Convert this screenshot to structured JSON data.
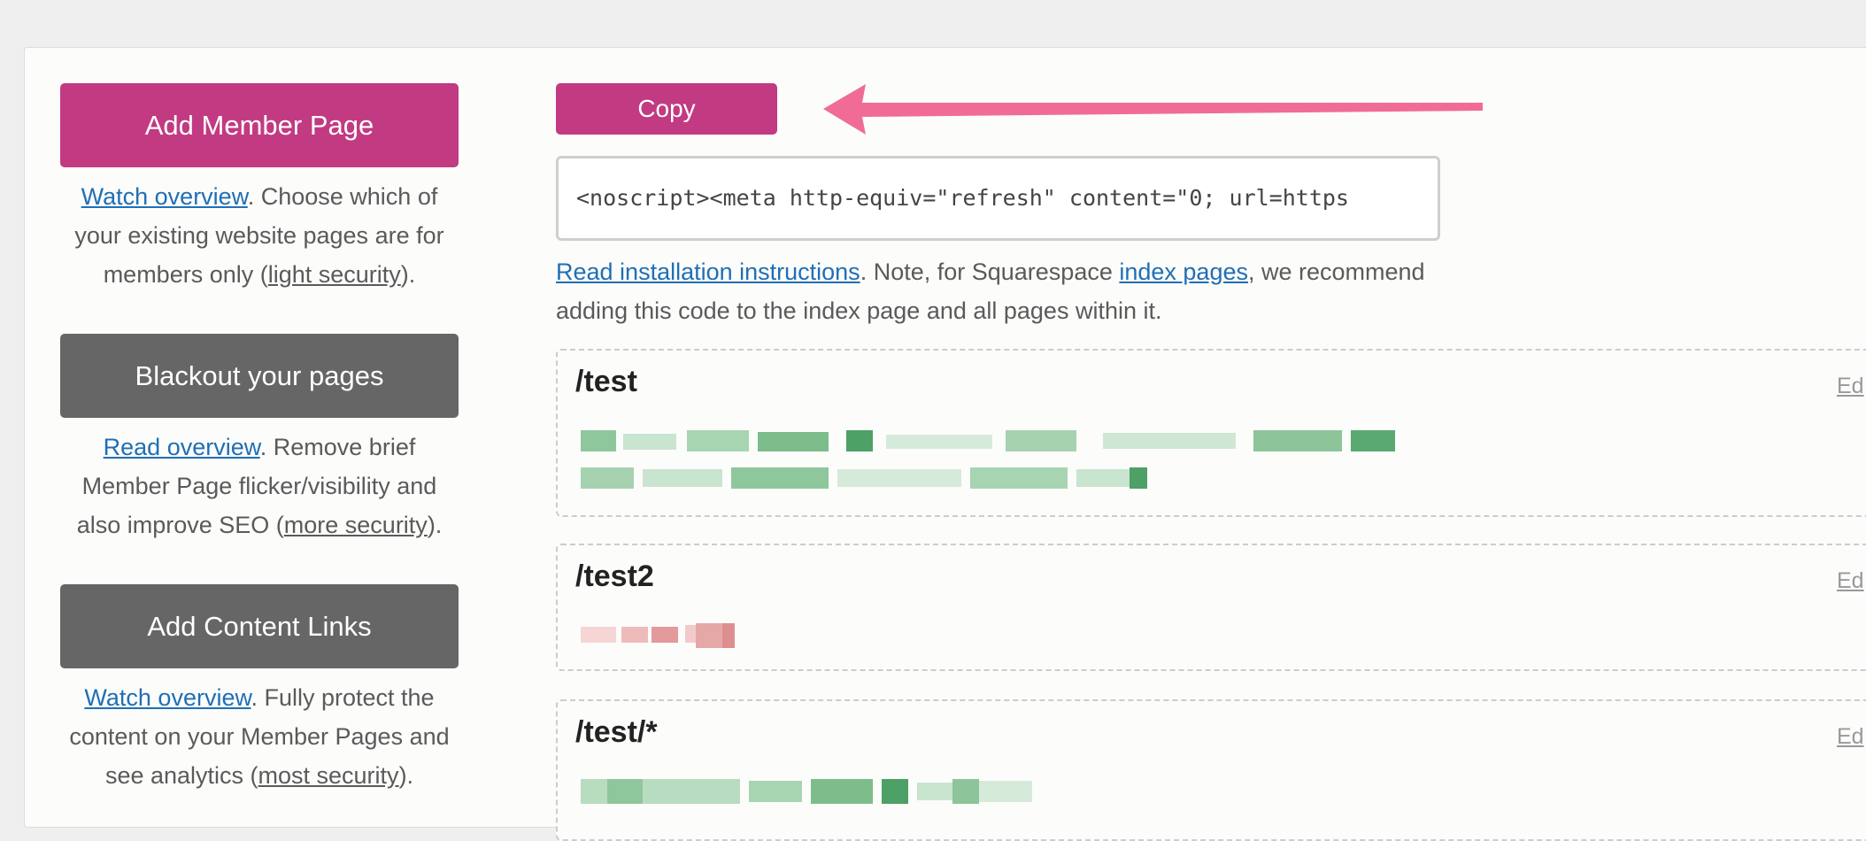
{
  "sidebar": {
    "add_member_page": {
      "label": "Add Member Page",
      "link": "Watch overview",
      "text": ". Choose which of your existing website pages are for members only (",
      "security": "light security",
      "end": ")."
    },
    "blackout": {
      "label": "Blackout your pages",
      "link": "Read overview",
      "text": ". Remove brief Member Page flicker/visibility and also improve SEO (",
      "security": "more security",
      "end": ")."
    },
    "content_links": {
      "label": "Add Content Links",
      "link": "Watch overview",
      "text": ". Fully protect the content on your Member Pages and see analytics (",
      "security": "most security",
      "end": ")."
    }
  },
  "main": {
    "copy_label": "Copy",
    "code": "<noscript><meta http-equiv=\"refresh\" content=\"0; url=https",
    "note_link1": "Read installation instructions",
    "note_text1": ". Note, for Squarespace ",
    "note_link2": "index pages",
    "note_text2": ", we recommend adding this code to the index page and all pages within it.",
    "pages": [
      {
        "path": "/test",
        "edit": "Ed"
      },
      {
        "path": "/test2",
        "edit": "Ed"
      },
      {
        "path": "/test/*",
        "edit": "Ed"
      }
    ]
  },
  "colors": {
    "accent": "#c13a82",
    "dark_button": "#666666",
    "link": "#1f6fb5",
    "arrow": "#f06c97"
  }
}
